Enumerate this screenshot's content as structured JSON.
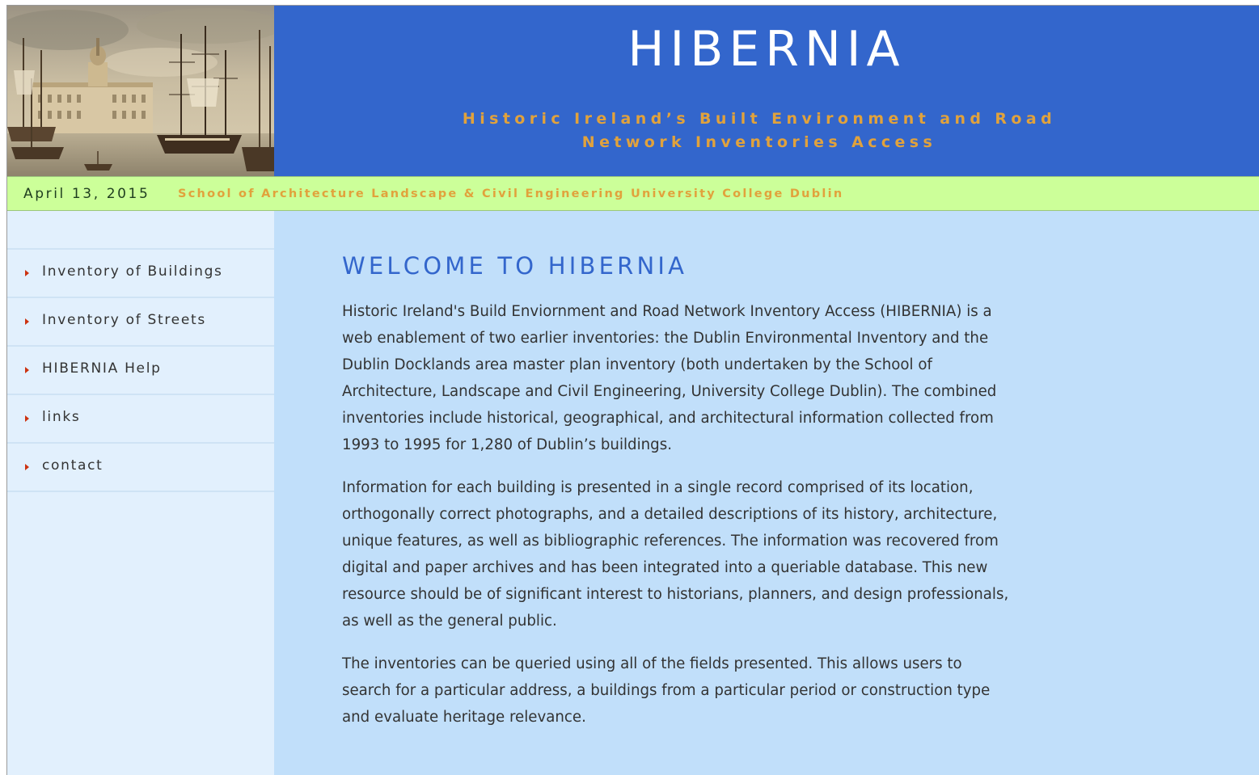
{
  "header": {
    "title": "HIBERNIA",
    "subtitle_line1": "Historic Ireland’s Built Environment and Road",
    "subtitle_line2": "Network Inventories Access",
    "image_alt": "historic-dublin-harbour-painting"
  },
  "info_bar": {
    "date": "April 13, 2015",
    "school": "School of Architecture Landscape & Civil Engineering University College Dublin"
  },
  "sidebar": {
    "items": [
      {
        "label": "Inventory of Buildings"
      },
      {
        "label": "Inventory of Streets"
      },
      {
        "label": "HIBERNIA Help"
      },
      {
        "label": "links"
      },
      {
        "label": "contact"
      }
    ]
  },
  "main": {
    "heading": "WELCOME TO HIBERNIA",
    "paragraphs": [
      "Historic Ireland's Build Enviornment and Road Network Inventory Access (HIBERNIA) is a web enablement of two earlier inventories:  the Dublin Environmental Inventory and the Dublin Docklands area master plan inventory (both undertaken by the School of Architecture, Landscape and Civil Engineering, University College Dublin). The combined inventories include historical, geographical, and architectural information collected from 1993 to 1995 for 1,280 of Dublin’s buildings.",
      "Information for each building is presented in a single record comprised of its location, orthogonally correct photographs, and a detailed descriptions of its history, architecture, unique features, as well as bibliographic references. The information was recovered from digital and paper archives and has been integrated into a queriable database. This new resource should be of significant interest to historians, planners, and design professionals, as well as the general public.",
      "The inventories can be queried using all of the fields presented. This allows users to search for a particular address, a buildings from a particular period or construction type and evaluate heritage relevance."
    ]
  },
  "colors": {
    "header_blue": "#3366cc",
    "subtitle_orange": "#e1a23c",
    "info_bar_green": "#ccff99",
    "main_bg": "#c1dffa",
    "sidebar_bg": "#e2f0fd",
    "nav_arrow_red": "#cc3311"
  }
}
